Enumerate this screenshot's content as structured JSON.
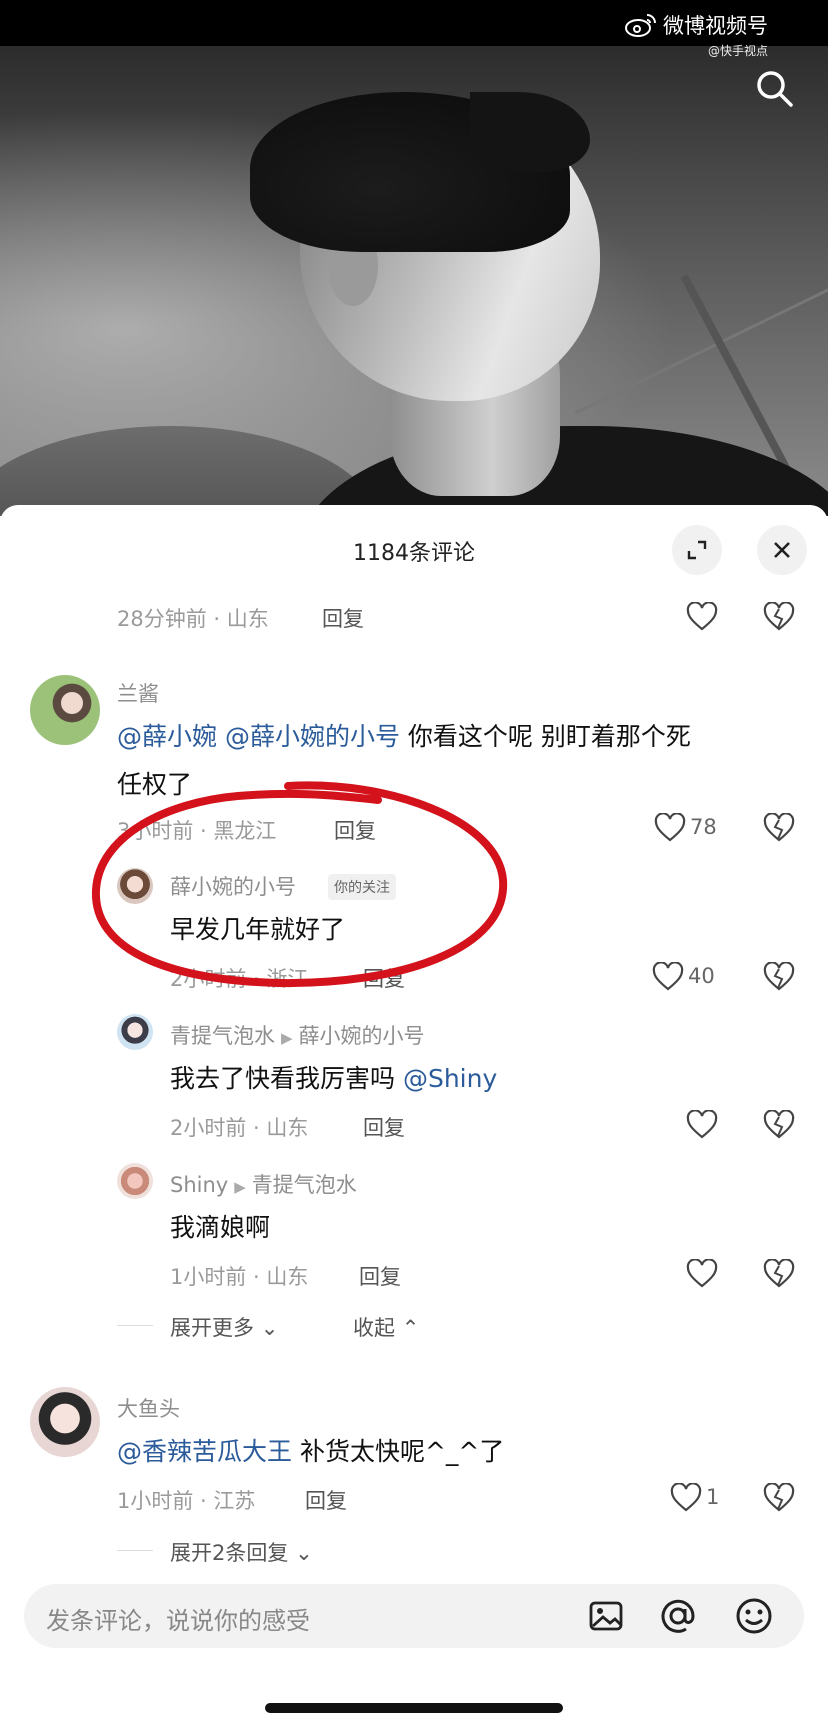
{
  "watermark": {
    "brand": "微博视频号",
    "handle": "@快手视点"
  },
  "sheet": {
    "title": "1184条评论"
  },
  "comments": [
    {
      "meta": "28分钟前 · 山东",
      "reply": "回复"
    },
    {
      "user": "兰酱",
      "mention1": "@薛小婉",
      "mention2": "@薛小婉的小号",
      "text_line1": " 你看这个呢  别盯着那个死",
      "text_line2": "任权了",
      "meta": "3小时前 · 黑龙江",
      "reply": "回复",
      "likes": "78"
    },
    {
      "user": "薛小婉的小号",
      "badge": "你的关注",
      "text": "早发几年就好了",
      "meta": "2小时前 · 浙江",
      "reply": "回复",
      "likes": "40"
    },
    {
      "user": "青提气泡水",
      "reply_to": "薛小婉的小号",
      "text": "我去了快看我厉害吗 ",
      "mention": "@Shiny",
      "meta": "2小时前 · 山东",
      "reply": "回复"
    },
    {
      "user": "Shiny",
      "reply_to": "青提气泡水",
      "text": "我滴娘啊",
      "meta": "1小时前 · 山东",
      "reply": "回复"
    },
    {
      "user": "大鱼头",
      "mention": "@香辣苦瓜大王",
      "text": " 补货太快呢^_^了",
      "meta": "1小时前 · 江苏",
      "reply": "回复",
      "likes": "1"
    }
  ],
  "thread_controls": {
    "expand_more": "展开更多",
    "collapse": "收起",
    "expand_two": "展开2条回复"
  },
  "input": {
    "placeholder": "发条评论，说说你的感受"
  },
  "colors": {
    "accent_red": "#d3121b",
    "mention_blue": "#2b5b9a"
  }
}
